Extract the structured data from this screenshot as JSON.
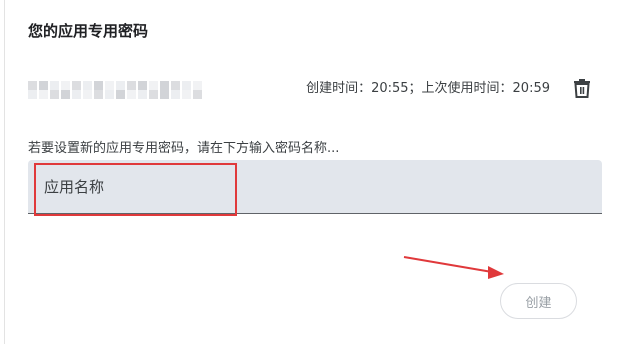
{
  "section": {
    "title": "您的应用专用密码"
  },
  "password_entry": {
    "meta": "创建时间：20:55；上次使用时间：20:59",
    "delete_icon": "trash-icon"
  },
  "new_password": {
    "hint": "若要设置新的应用专用密码，请在下方输入密码名称...",
    "input_placeholder": "应用名称",
    "input_value": ""
  },
  "actions": {
    "create_label": "创建"
  },
  "annotations": {
    "highlight_color": "#e0393b",
    "arrow_color": "#e0393b"
  },
  "colors": {
    "input_background": "#e2e6ec",
    "disabled_text": "#9aa0a6"
  }
}
